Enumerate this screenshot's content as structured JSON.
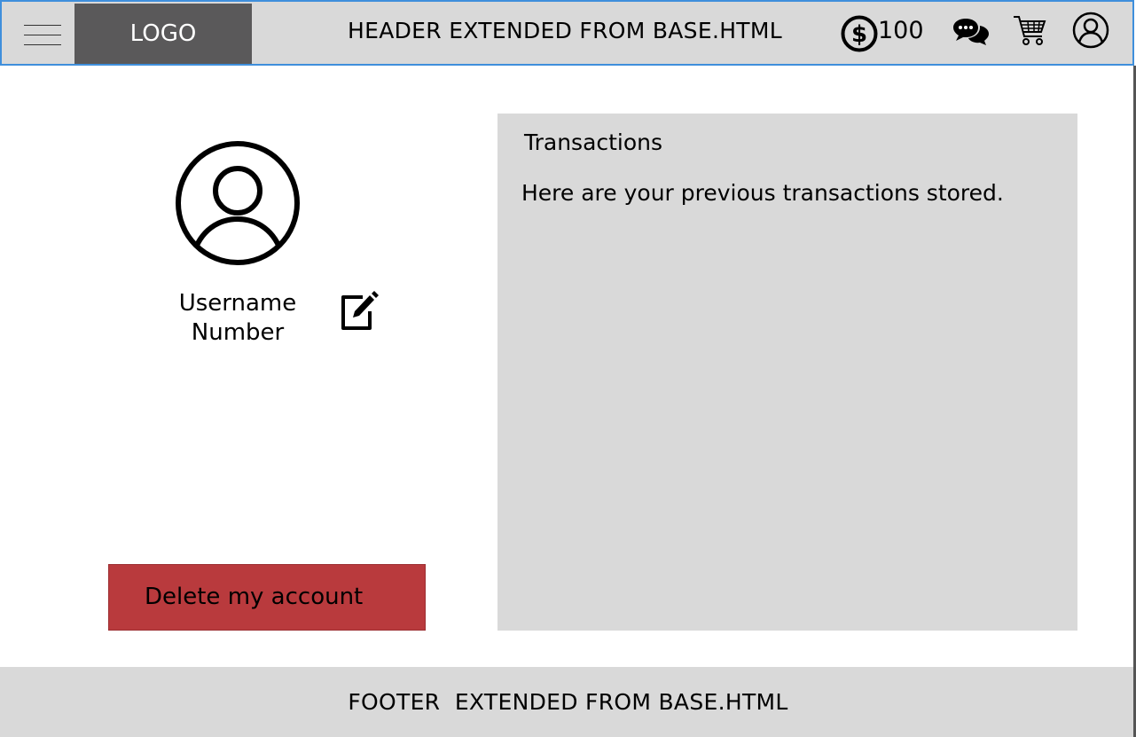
{
  "header": {
    "menu_icon": "hamburger-icon",
    "logo_text": "LOGO",
    "title": "HEADER EXTENDED FROM BASE.HTML",
    "balance": "100",
    "icons": [
      "dollar-coin-icon",
      "chat-icon",
      "cart-icon",
      "user-icon"
    ]
  },
  "profile": {
    "avatar_icon": "user-avatar-icon",
    "username": "Username",
    "number": "Number",
    "edit_icon": "edit-icon",
    "delete_label": "Delete my account"
  },
  "transactions": {
    "title": "Transactions",
    "description": "Here are your previous transactions stored."
  },
  "footer": {
    "text": "FOOTER  EXTENDED FROM BASE.HTML"
  },
  "colors": {
    "panel": "#d9d9d9",
    "logo_bg": "#5a595a",
    "header_border": "#3f8fdc",
    "delete_button": "#b93a3d"
  }
}
